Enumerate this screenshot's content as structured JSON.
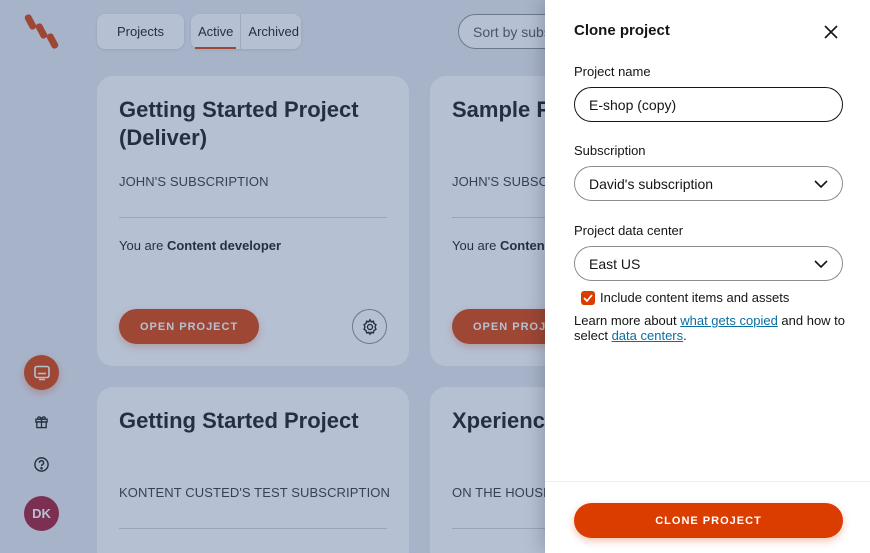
{
  "topbar": {
    "projects_label": "Projects",
    "filter_active": "Active",
    "filter_archived": "Archived",
    "sort_placeholder": "Sort by subs"
  },
  "rail": {
    "avatar_initials": "DK"
  },
  "cards": [
    {
      "title": "Getting Started Project (Deliver)",
      "subscription": "JOHN'S SUBSCRIPTION",
      "role_prefix": "You are ",
      "role": "Content developer",
      "open_label": "OPEN PROJECT"
    },
    {
      "title": "Sample P",
      "subscription": "JOHN'S SUBSCRI",
      "role_prefix": "You are ",
      "role": "Content",
      "open_label": "OPEN PROJE"
    },
    {
      "title": "Getting Started Project",
      "subscription": "KONTENT CUSTED'S TEST SUBSCRIPTION"
    },
    {
      "title": "Xperience",
      "subscription": "ON THE HOUSE"
    }
  ],
  "panel": {
    "title": "Clone project",
    "project_name_label": "Project name",
    "project_name_value": "E-shop (copy)",
    "subscription_label": "Subscription",
    "subscription_value": "David's subscription",
    "datacenter_label": "Project data center",
    "datacenter_value": "East US",
    "include_label": "Include content items and assets",
    "include_checked": true,
    "info_prefix": "Learn more about ",
    "info_link1": "what gets copied",
    "info_middle": " and how to select ",
    "info_link2": "data centers",
    "info_suffix": ".",
    "clone_label": "CLONE PROJECT"
  },
  "colors": {
    "accent": "#db3c00",
    "link": "#0a6ea3",
    "avatar": "#a3182e"
  }
}
